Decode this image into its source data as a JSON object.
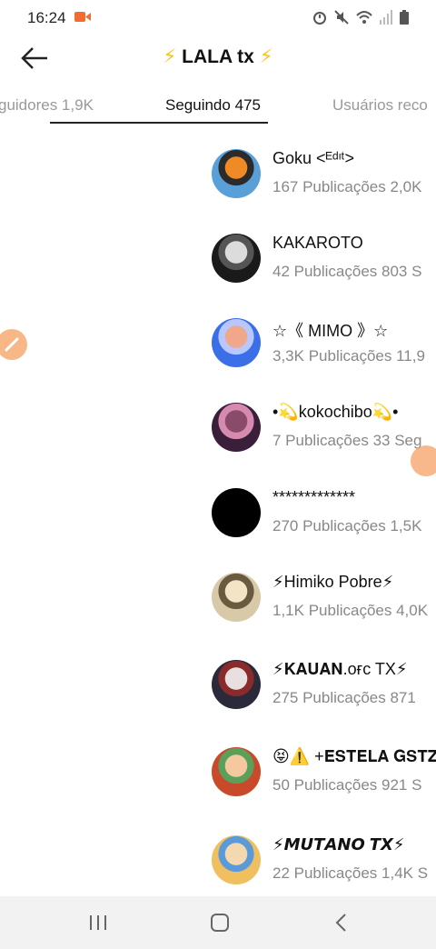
{
  "status": {
    "time": "16:24",
    "icons": [
      "alarm-icon",
      "mute-icon",
      "wifi-icon",
      "signal-icon",
      "battery-icon"
    ]
  },
  "header": {
    "title_bolt_left": "⚡",
    "title": "LALA tx",
    "title_bolt_right": "⚡"
  },
  "tabs": [
    {
      "label": "guidores 1,9K",
      "active": false
    },
    {
      "label": "Seguindo 475",
      "active": true
    },
    {
      "label": "Usuários reco",
      "active": false
    }
  ],
  "users": [
    {
      "name": "Goku <ᴱᵈᶦᵗ>",
      "stats": "167 Publicações   2,0K",
      "avatar_colors": [
        "#5aa0d8",
        "#f08a24",
        "#2b2b2b"
      ]
    },
    {
      "name": "KAKAROTO",
      "stats": "42 Publicações   803 S",
      "avatar_colors": [
        "#1a1a1a",
        "#dcdcdc",
        "#555555"
      ]
    },
    {
      "name": "☆《 MIMO 》☆",
      "stats": "3,3K Publicações   11,9",
      "avatar_colors": [
        "#3a6fe8",
        "#f0a78a",
        "#b8c8ff"
      ]
    },
    {
      "name": "•💫kokochibo💫•",
      "stats": "7 Publicações   33 Seg",
      "avatar_colors": [
        "#3a1f3a",
        "#8a4a6a",
        "#d68ab0"
      ]
    },
    {
      "name": "*************",
      "stats": "270 Publicações   1,5K",
      "avatar_colors": [
        "#000000",
        "#000000",
        "#000000"
      ]
    },
    {
      "name": "⚡Himiko Pobre⚡",
      "stats": "1,1K Publicações   4,0K",
      "avatar_colors": [
        "#d8c9a8",
        "#f2e4c4",
        "#6a5a40"
      ]
    },
    {
      "name": "⚡𝐊𝐀𝐔𝐀𝐍.ᴏғᴄ TX⚡",
      "stats": "275 Publicações   871",
      "avatar_colors": [
        "#2a2a3a",
        "#e8e0e0",
        "#8a2a2a"
      ]
    },
    {
      "name": "😝⚠️ +𝐄𝐒𝐓𝐄𝐋𝐀 𝐆𝐒𝐓𝐙",
      "stats": "50 Publicações   921 S",
      "avatar_colors": [
        "#c84a2a",
        "#f6c8a0",
        "#5aa05a"
      ]
    },
    {
      "name": "⚡𝙈𝙐𝙏𝘼𝙉𝙊 𝙏𝙓⚡",
      "stats": "22 Publicações   1,4K S",
      "avatar_colors": [
        "#f0c060",
        "#f4d8b0",
        "#5a9ad8"
      ]
    }
  ],
  "colors": {
    "accent": "#f5c518",
    "muted_text": "#888888",
    "nav_bg": "#f2f2f2"
  }
}
